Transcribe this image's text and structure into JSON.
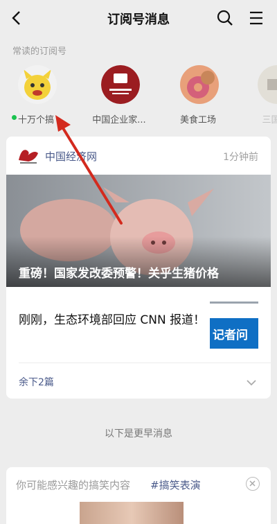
{
  "header": {
    "title": "订阅号消息"
  },
  "section_label": "常读的订阅号",
  "subscriptions": [
    {
      "name": "十万个搞"
    },
    {
      "name": "中国企业家..."
    },
    {
      "name": "美食工场"
    },
    {
      "name": "三国志"
    }
  ],
  "card": {
    "source_name": "中国经济网",
    "time": "1分钟前",
    "hero_title": "重磅！国家发改委预警！关乎生猪价格",
    "item2_title": "刚刚，生态环境部回应 CNN 报道！",
    "thumb_text": "记者问",
    "more_label": "余下2篇"
  },
  "earlier_label": "以下是更早消息",
  "card2": {
    "text": "你可能感兴趣的搞笑内容",
    "tag": "#搞笑表演"
  },
  "colors": {
    "background": "#ededed",
    "link_blue": "#4a5a8a",
    "unread_green": "#19c24e",
    "arrow_red": "#d32a1e"
  }
}
